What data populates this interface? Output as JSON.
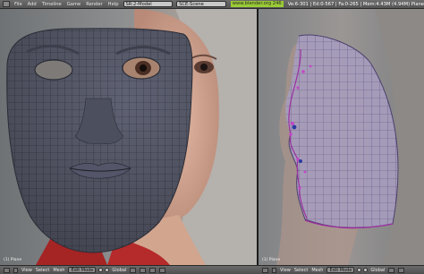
{
  "topbar": {
    "menus": [
      "File",
      "Add",
      "Timeline",
      "Game",
      "Render",
      "Help"
    ],
    "screen_field": "SR:2-Model",
    "scene_field": "SCE:Scene",
    "site": "www.blender.org 246",
    "stats": "Ve:6-301 | Ed:0-567 | Fa:0-265 | Mem:4.43M (4.94M) Plane"
  },
  "left_view": {
    "corner_label": "(1) Plane"
  },
  "right_view": {
    "corner_label": "(1) Plane"
  },
  "left_header": {
    "view": "View",
    "select": "Select",
    "mesh": "Mesh",
    "mode": "Edit Mode",
    "pivot": "Global"
  },
  "right_header": {
    "view": "View",
    "select": "Select",
    "mesh": "Mesh",
    "mode": "Edit Mode",
    "pivot": "Global"
  },
  "colors": {
    "mesh_left": "#5d6071",
    "mesh_right": "#a8a0bf",
    "ui_bg": "#5a5a5a",
    "site_green": "#9acb35"
  }
}
